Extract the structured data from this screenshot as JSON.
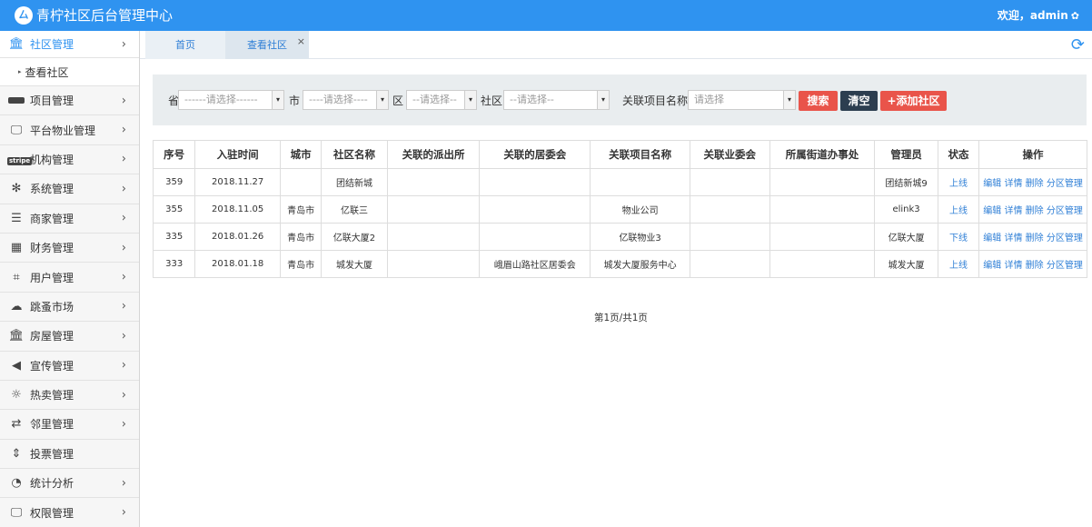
{
  "header": {
    "logo_glyph": "⼛",
    "title": "青柠社区后台管理中心",
    "user_text": "欢迎，admin",
    "gear_glyph": "✿"
  },
  "sidebar": {
    "items": [
      {
        "label": "社区管理",
        "icon": "bank-icon",
        "glyph": "🏛",
        "active": true
      },
      {
        "label": "项目管理",
        "icon": "lab-icon",
        "glyph": ""
      },
      {
        "label": "平台物业管理",
        "icon": "monitor-icon",
        "glyph": "🖵"
      },
      {
        "label": "机构管理",
        "icon": "stripe-icon",
        "glyph": "stripe"
      },
      {
        "label": "系统管理",
        "icon": "pinwheel-icon",
        "glyph": "✻"
      },
      {
        "label": "商家管理",
        "icon": "menu-icon",
        "glyph": "☰"
      },
      {
        "label": "财务管理",
        "icon": "calculator-icon",
        "glyph": "▦"
      },
      {
        "label": "用户管理",
        "icon": "crop-icon",
        "glyph": "⌗"
      },
      {
        "label": "跳蚤市场",
        "icon": "cloud-icon",
        "glyph": "☁"
      },
      {
        "label": "房屋管理",
        "icon": "bank-icon",
        "glyph": "🏛"
      },
      {
        "label": "宣传管理",
        "icon": "volume-icon",
        "glyph": "◀"
      },
      {
        "label": "热卖管理",
        "icon": "sun-icon",
        "glyph": "☼"
      },
      {
        "label": "邻里管理",
        "icon": "retweet-icon",
        "glyph": "⇄"
      },
      {
        "label": "投票管理",
        "icon": "sort-icon",
        "glyph": "⇕"
      },
      {
        "label": "统计分析",
        "icon": "pie-chart-icon",
        "glyph": "◔"
      },
      {
        "label": "权限管理",
        "icon": "monitor-icon",
        "glyph": "🖵"
      }
    ],
    "sub_item": "查看社区",
    "chevron": "›",
    "sub_marker": "▸"
  },
  "tabs": {
    "home": "首页",
    "current": "查看社区",
    "close": "×",
    "refresh_glyph": "⟳"
  },
  "filters": {
    "province_label": "省",
    "province_value": "------请选择------",
    "city_label": "市",
    "city_value": "----请选择----",
    "district_label": "区",
    "district_value": "--请选择--",
    "community_label": "社区",
    "community_value": "--请选择--",
    "project_label": "关联项目名称",
    "project_placeholder": "请选择",
    "arrow": "▾",
    "search_btn": "搜索",
    "clear_btn": "清空",
    "add_btn": "+添加社区"
  },
  "table": {
    "headers": [
      "序号",
      "入驻时间",
      "城市",
      "社区名称",
      "关联的派出所",
      "关联的居委会",
      "关联项目名称",
      "关联业委会",
      "所属街道办事处",
      "管理员",
      "状态",
      "操作"
    ],
    "rows": [
      {
        "id": "359",
        "date": "2018.11.27",
        "city": "",
        "name": "团结新城",
        "police": "",
        "committee": "",
        "project": "",
        "owners": "",
        "street": "",
        "admin": "团结新城9",
        "status": "上线"
      },
      {
        "id": "355",
        "date": "2018.11.05",
        "city": "青岛市",
        "name": "亿联三",
        "police": "",
        "committee": "",
        "project": "物业公司",
        "owners": "",
        "street": "",
        "admin": "elink3",
        "status": "上线"
      },
      {
        "id": "335",
        "date": "2018.01.26",
        "city": "青岛市",
        "name": "亿联大厦2",
        "police": "",
        "committee": "",
        "project": "亿联物业3",
        "owners": "",
        "street": "",
        "admin": "亿联大厦",
        "status": "下线"
      },
      {
        "id": "333",
        "date": "2018.01.18",
        "city": "青岛市",
        "name": "城发大厦",
        "police": "",
        "committee": "峨眉山路社区居委会",
        "project": "城发大厦服务中心",
        "owners": "",
        "street": "",
        "admin": "城发大厦",
        "status": "上线"
      }
    ],
    "ops": [
      "编辑",
      "详情",
      "删除",
      "分区管理"
    ]
  },
  "pager": {
    "text": "第1页/共1页"
  },
  "colors": {
    "primary": "#2f93f0",
    "danger": "#e9544a",
    "dark": "#2c3e50",
    "link": "#2f7fd6"
  }
}
